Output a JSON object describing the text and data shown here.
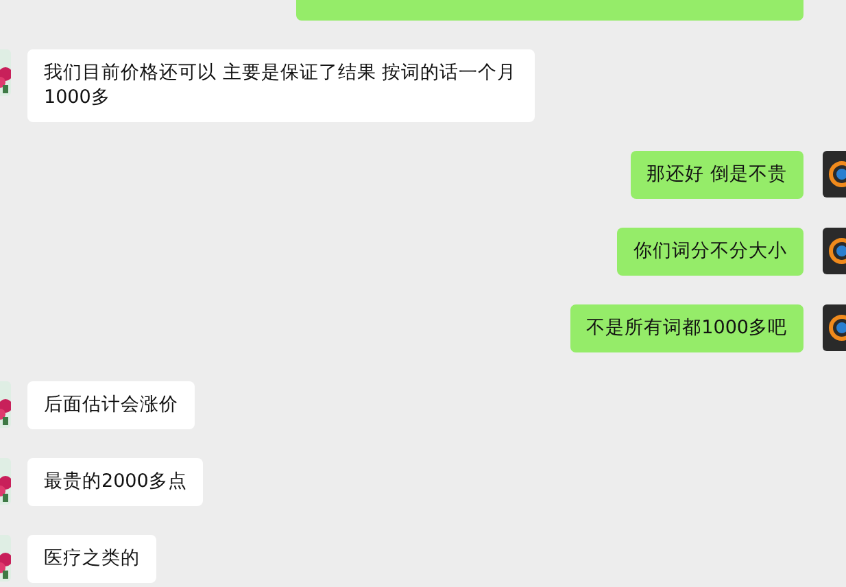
{
  "messages": [
    {
      "kind": "sent"
    },
    {
      "kind": "received",
      "text": "我们目前价格还可以 主要是保证了结果 按词的话一个月1000多"
    },
    {
      "kind": "sent",
      "text": "那还好 倒是不贵"
    },
    {
      "kind": "sent",
      "text": "你们词分不分大小"
    },
    {
      "kind": "sent",
      "text": "不是所有词都1000多吧"
    },
    {
      "kind": "received",
      "text": "后面估计会涨价"
    },
    {
      "kind": "received",
      "text": "最贵的2000多点"
    },
    {
      "kind": "received",
      "text": "医疗之类的"
    }
  ]
}
